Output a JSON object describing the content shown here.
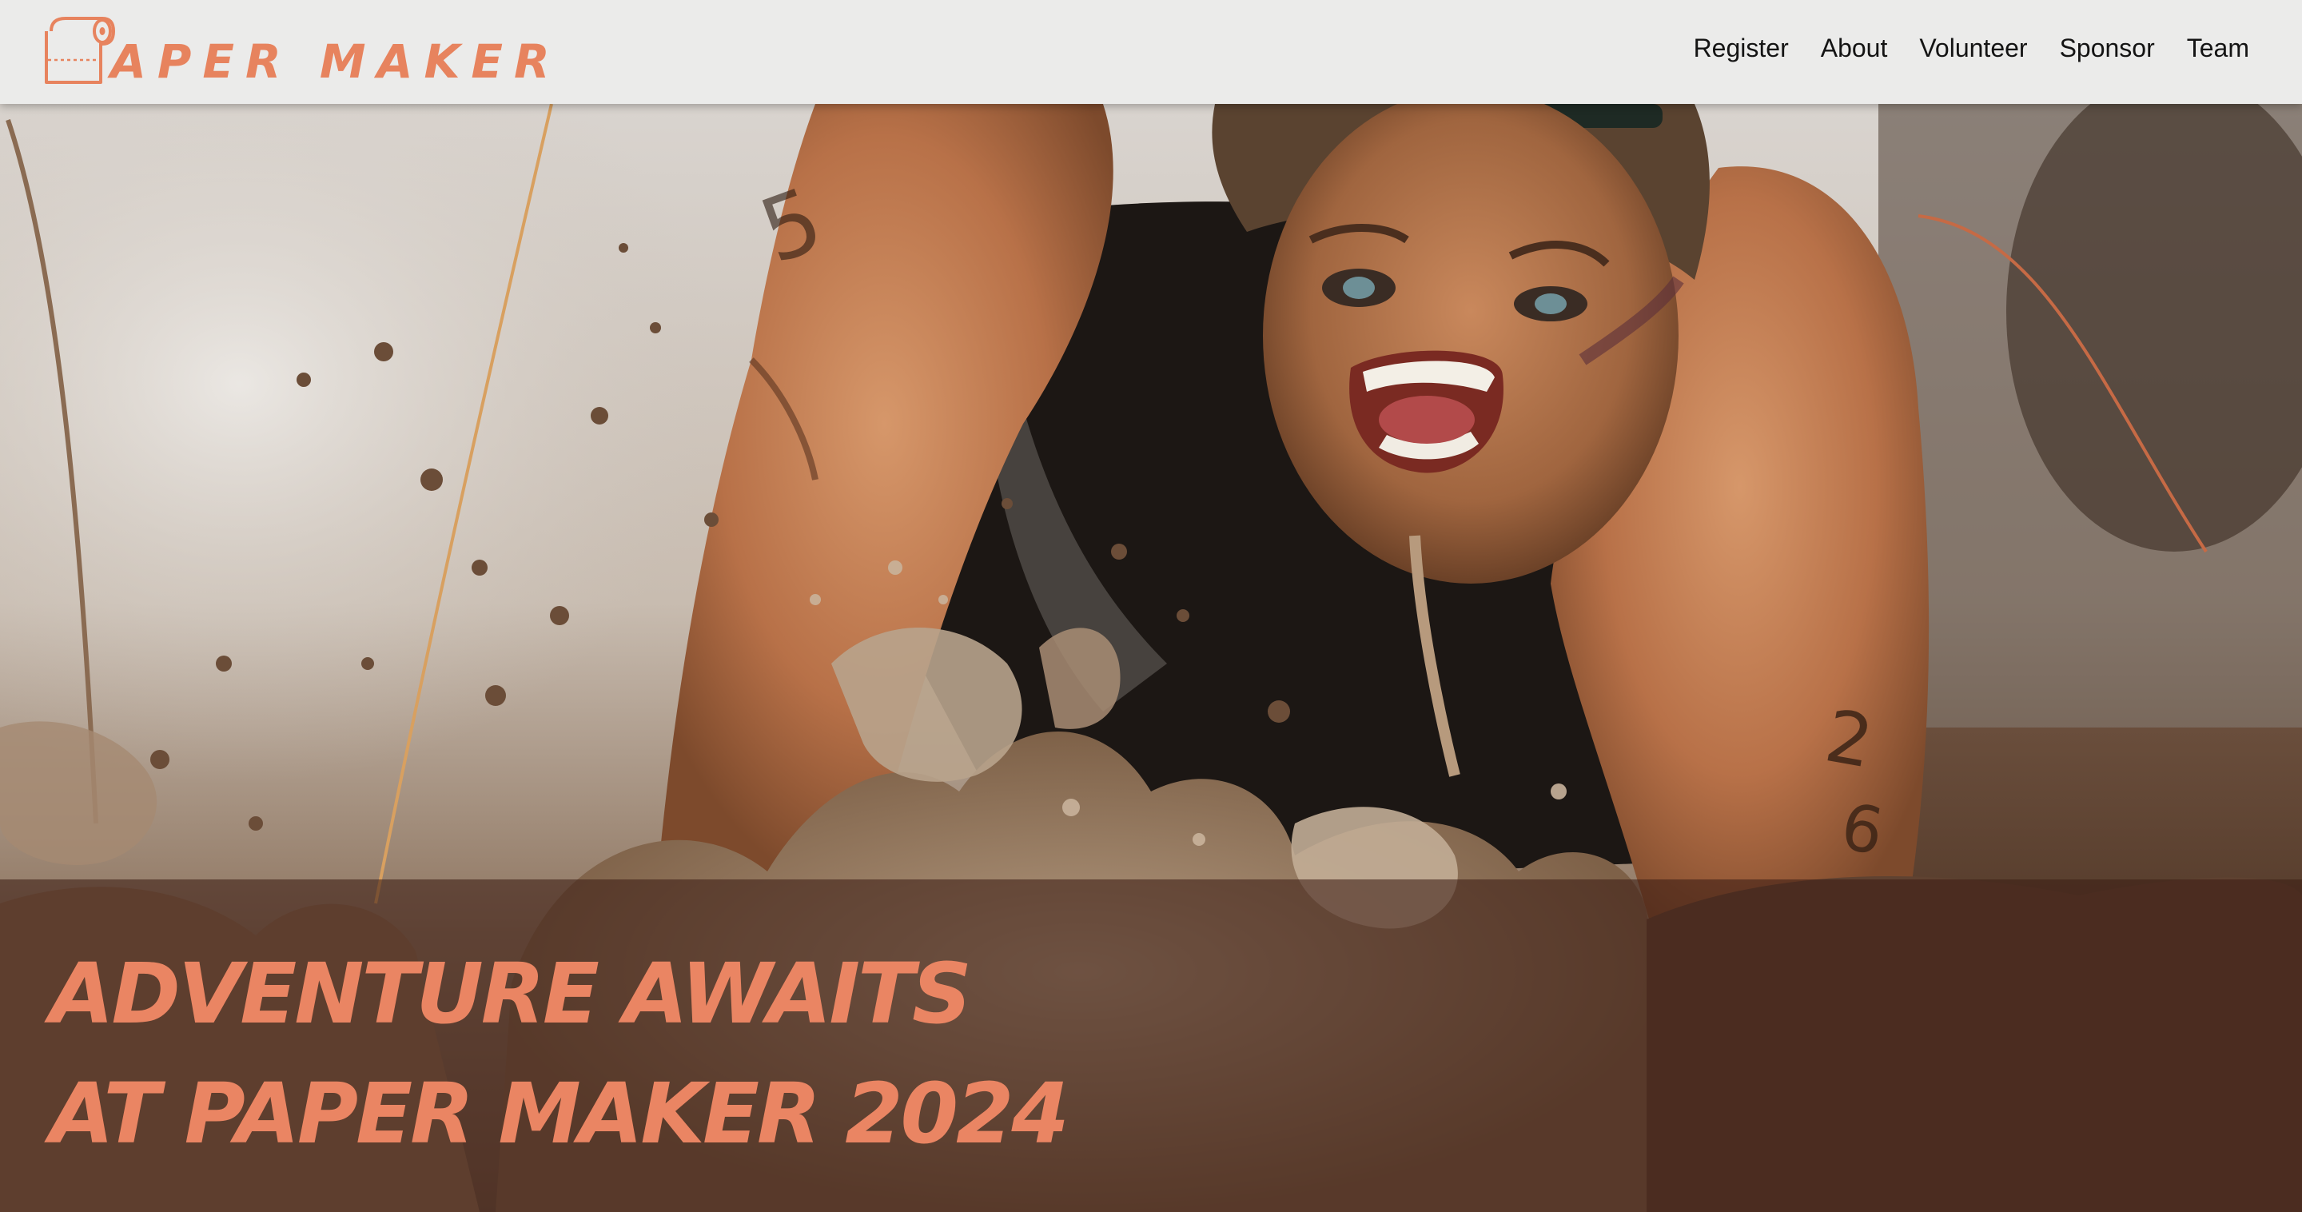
{
  "brand": {
    "name": "APER MAKER",
    "accent_color": "#e7835e",
    "icon": "toilet-paper-roll-icon"
  },
  "nav": {
    "items": [
      {
        "label": "Register"
      },
      {
        "label": "About"
      },
      {
        "label": "Volunteer"
      },
      {
        "label": "Sponsor"
      },
      {
        "label": "Team"
      }
    ]
  },
  "hero": {
    "image_subject": "mud-run-crawl-photo",
    "headline_line1": "ADVENTURE AWAITS",
    "headline_line2": "AT PAPER MAKER 2024",
    "headline_color": "#ea8563"
  }
}
